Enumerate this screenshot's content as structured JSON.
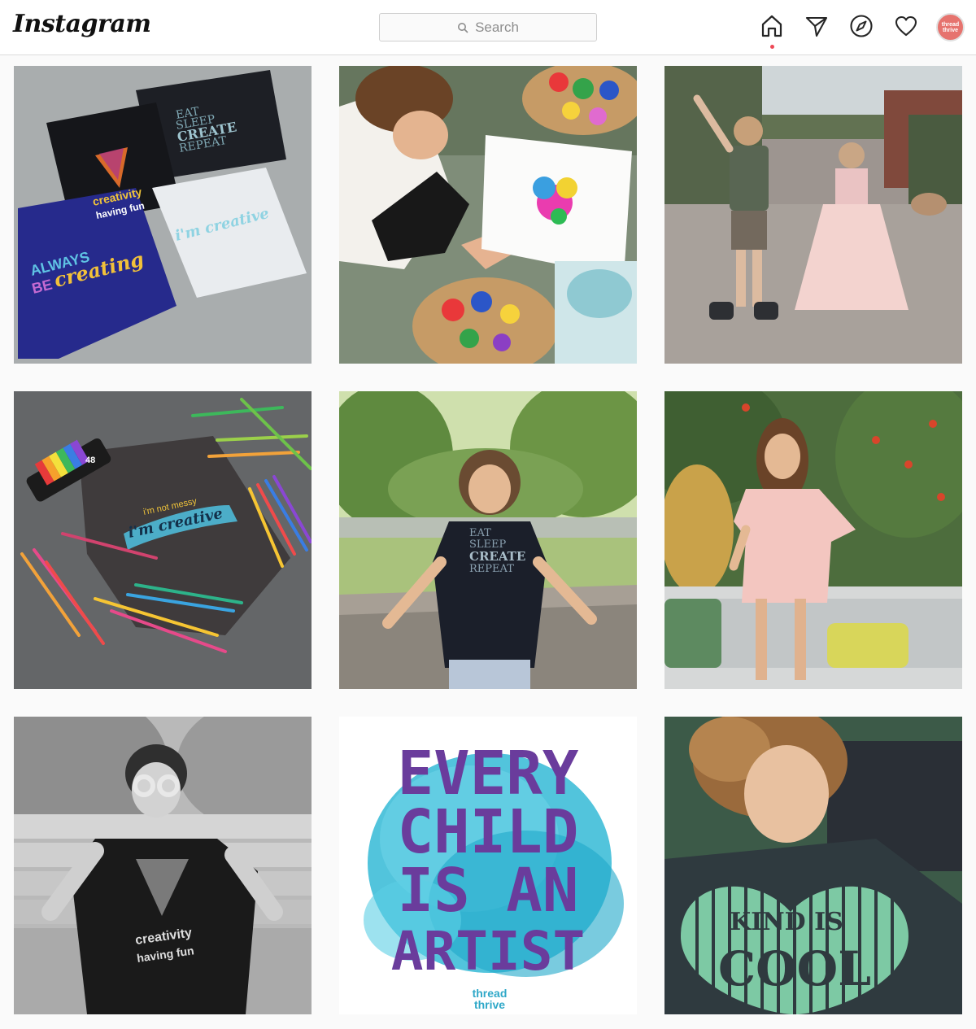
{
  "header": {
    "logo_text": "Instagram",
    "search_placeholder": "Search",
    "nav": [
      {
        "icon": "home-icon",
        "active": true
      },
      {
        "icon": "paper-plane-icon"
      },
      {
        "icon": "compass-icon"
      },
      {
        "icon": "heart-icon"
      }
    ],
    "avatar": {
      "line1": "thread",
      "line2": "thrive"
    }
  },
  "posts": [
    {
      "scene": "tshirts-flatlay",
      "texts": {
        "t1": "creativity",
        "t2": "having fun",
        "t3": "EAT",
        "t4": "SLEEP",
        "t5": "CREATE",
        "t6": "REPEAT",
        "t7": "ALWAYS",
        "t8": "BE",
        "t9": "creating",
        "t10": "i'm creative"
      }
    },
    {
      "scene": "child-painting"
    },
    {
      "scene": "kids-dancing-garden"
    },
    {
      "scene": "pencils-tshirt",
      "texts": {
        "t1": "i'm not messy",
        "t2": "i'm creative",
        "t3": "48"
      }
    },
    {
      "scene": "boy-on-deck",
      "texts": {
        "t1": "EAT",
        "t2": "SLEEP",
        "t3": "CREATE",
        "t4": "REPEAT"
      }
    },
    {
      "scene": "girl-pink-shirt"
    },
    {
      "scene": "boy-bw-goggles",
      "texts": {
        "t1": "creativity",
        "t2": "having fun"
      }
    },
    {
      "scene": "every-child-artist",
      "texts": {
        "l1": "EVERY",
        "l2": "CHILD",
        "l3": "IS AN",
        "l4": "ARTIST",
        "b1": "thread",
        "b2": "thrive"
      }
    },
    {
      "scene": "kind-is-cool",
      "texts": {
        "t1": "KIND IS",
        "t2": "COOL"
      }
    }
  ]
}
